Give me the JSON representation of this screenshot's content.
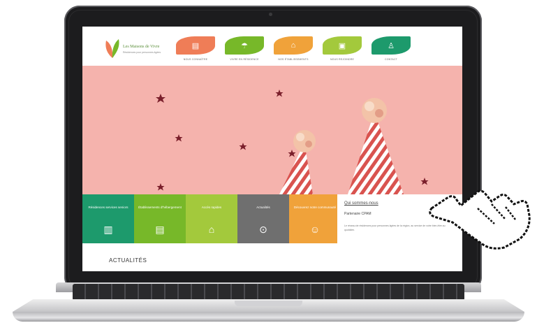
{
  "site": {
    "logo_title": "Les Maisons de Vivre",
    "logo_subtitle": "Résidences pour personnes âgées"
  },
  "nav": [
    {
      "label": "Nous connaître",
      "icon": "document-icon",
      "color": "#ef7d57"
    },
    {
      "label": "Vivre en résidence",
      "icon": "umbrella-icon",
      "color": "#77b829"
    },
    {
      "label": "Nos établissements",
      "icon": "houses-icon",
      "color": "#f0a23a"
    },
    {
      "label": "Nous rejoindre",
      "icon": "clipboard-icon",
      "color": "#a3c93c"
    },
    {
      "label": "Contact",
      "icon": "person-icon",
      "color": "#1d9a6c"
    }
  ],
  "tiles": [
    {
      "label": "Résidences services seniors",
      "icon": "building-icon",
      "color": "#1d9a6c"
    },
    {
      "label": "Établissements d'hébergement",
      "icon": "document-icon",
      "color": "#77b829"
    },
    {
      "label": "Accès rapides",
      "icon": "houses-icon",
      "color": "#a3c93c"
    },
    {
      "label": "Actualités",
      "icon": "pin-icon",
      "color": "#6f6f6f"
    },
    {
      "label": "Découvrez notre communauté",
      "icon": "people-icon",
      "color": "#f0a23a"
    }
  ],
  "info": {
    "title": "Qui sommes-nous",
    "subtitle": "Partenaire CPAM",
    "text": "Le réseau de résidences pour personnes âgées de la région, au service de votre bien-être au quotidien."
  },
  "news_heading": "ACTUALITÉS"
}
